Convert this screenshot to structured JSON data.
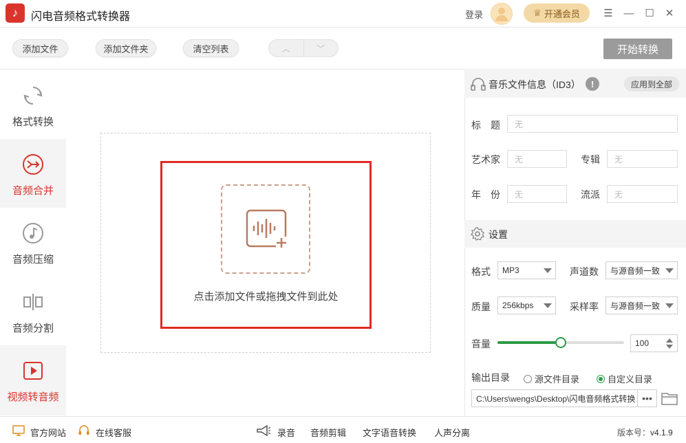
{
  "titlebar": {
    "title": "闪电音频格式转换器",
    "login": "登录",
    "vip_label": "开通会员"
  },
  "toolbar": {
    "add_file": "添加文件",
    "add_folder": "添加文件夹",
    "clear_list": "清空列表",
    "start": "开始转换"
  },
  "sidebar": {
    "items": [
      {
        "label": "格式转换"
      },
      {
        "label": "音频合并"
      },
      {
        "label": "音频压缩"
      },
      {
        "label": "音频分割"
      },
      {
        "label": "视频转音频"
      }
    ]
  },
  "dropzone": {
    "hint": "点击添加文件或拖拽文件到此处"
  },
  "id3": {
    "title": "音乐文件信息（ID3）",
    "apply_all": "应用到全部",
    "fields": {
      "title_label": "标　题",
      "title_value": "无",
      "artist_label": "艺术家",
      "artist_value": "无",
      "album_label": "专辑",
      "album_value": "无",
      "year_label": "年　份",
      "year_value": "无",
      "genre_label": "流派",
      "genre_value": "无"
    }
  },
  "settings": {
    "title": "设置",
    "format_label": "格式",
    "format_value": "MP3",
    "channels_label": "声道数",
    "channels_value": "与源音频一致",
    "quality_label": "质量",
    "quality_value": "256kbps",
    "samplerate_label": "采样率",
    "samplerate_value": "与源音频一致",
    "volume_label": "音量",
    "volume_value": "100",
    "volume_slider_fraction": 0.5,
    "output_label": "输出目录",
    "source_dir": "源文件目录",
    "custom_dir": "自定义目录",
    "output_path": "C:\\Users\\wengs\\Desktop\\闪电音频格式转换",
    "dots": "•••"
  },
  "bottombar": {
    "website": "官方网站",
    "service": "在线客服",
    "record": "录音",
    "edit": "音频剪辑",
    "tts": "文字语音转换",
    "vocal": "人声分离",
    "version_label": "版本号：",
    "version_value": "v4.1.9"
  },
  "colors": {
    "brand_red": "#d9342b",
    "accent_green": "#2e9b47",
    "vip_gold": "#f3d9a6"
  }
}
